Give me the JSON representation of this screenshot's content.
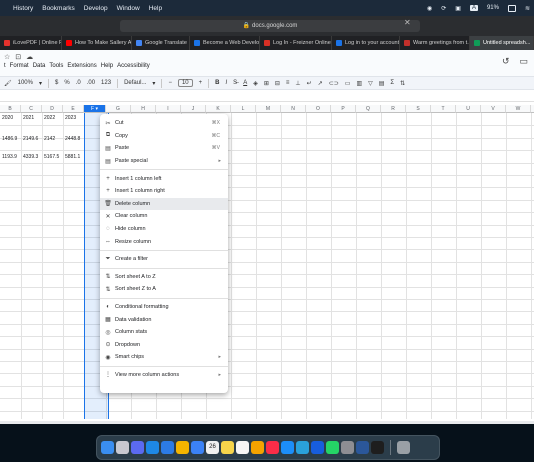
{
  "mac_menubar": {
    "items": [
      "History",
      "Bookmarks",
      "Develop",
      "Window",
      "Help"
    ],
    "battery": "91%"
  },
  "browser": {
    "url": "docs.google.com",
    "tabs": [
      {
        "label": "iLovePDF | Online PDF...",
        "color": "#e5322d"
      },
      {
        "label": "How To Make Sallery A...",
        "color": "#ff0000"
      },
      {
        "label": "Google Translate",
        "color": "#4285f4"
      },
      {
        "label": "Become a Web Develo...",
        "color": "#1a73e8"
      },
      {
        "label": "Log In - Freizner Online",
        "color": "#d93025"
      },
      {
        "label": "Log in to your account...",
        "color": "#1a73e8"
      },
      {
        "label": "Warm greetings from t...",
        "color": "#c4302b"
      },
      {
        "label": "Untitled spreadsh...",
        "color": "#0f9d58"
      }
    ]
  },
  "sheets": {
    "menus": [
      "t",
      "Format",
      "Data",
      "Tools",
      "Extensions",
      "Help",
      "Accessibility"
    ],
    "toolbar": {
      "zoom": "100%",
      "currency": "$",
      "percent": "%",
      "decimals_dec": ".0",
      "decimals_inc": ".00",
      "numfmt": "123",
      "font": "Defaul...",
      "font_size": "10",
      "bold": "B",
      "italic": "I"
    },
    "columns": [
      "B",
      "C",
      "D",
      "E",
      "F",
      "G",
      "H",
      "I",
      "J",
      "K",
      "L",
      "M",
      "N",
      "O",
      "P",
      "Q",
      "R",
      "S",
      "T",
      "U",
      "V",
      "W",
      "X"
    ],
    "selected_column": "F",
    "cells": {
      "row1": [
        "2020",
        "2021",
        "2022",
        "2023"
      ],
      "row2": [
        "1486.9",
        "2149.6",
        "2142",
        "2448.8"
      ],
      "row3": [
        "1193.9",
        "4339.3",
        "5167.5",
        "5881.1"
      ]
    }
  },
  "context_menu": {
    "groups": [
      [
        {
          "icon": "scissors-icon",
          "glyph": "✂",
          "label": "Cut",
          "shortcut": "⌘X"
        },
        {
          "icon": "copy-icon",
          "glyph": "⧉",
          "label": "Copy",
          "shortcut": "⌘C"
        },
        {
          "icon": "paste-icon",
          "glyph": "▤",
          "label": "Paste",
          "shortcut": "⌘V"
        },
        {
          "icon": "paste-special-icon",
          "glyph": "▤",
          "label": "Paste special",
          "arrow": "▸"
        }
      ],
      [
        {
          "icon": "plus-icon",
          "glyph": "+",
          "label": "Insert 1 column left"
        },
        {
          "icon": "plus-icon",
          "glyph": "+",
          "label": "Insert 1 column right"
        },
        {
          "icon": "trash-icon",
          "glyph": "🗑",
          "label": "Delete column",
          "hover": true
        },
        {
          "icon": "close-icon",
          "glyph": "✕",
          "label": "Clear column"
        },
        {
          "icon": "hide-icon",
          "glyph": "◌",
          "label": "Hide column"
        },
        {
          "icon": "resize-icon",
          "glyph": "⇔",
          "label": "Resize column"
        }
      ],
      [
        {
          "icon": "filter-icon",
          "glyph": "⏷",
          "label": "Create a filter"
        }
      ],
      [
        {
          "icon": "sort-icon",
          "glyph": "⇅",
          "label": "Sort sheet A to Z"
        },
        {
          "icon": "sort-icon",
          "glyph": "⇅",
          "label": "Sort sheet Z to A"
        }
      ],
      [
        {
          "icon": "palette-icon",
          "glyph": "◐",
          "label": "Conditional formatting"
        },
        {
          "icon": "validation-icon",
          "glyph": "▦",
          "label": "Data validation"
        },
        {
          "icon": "lightbulb-icon",
          "glyph": "◎",
          "label": "Column stats"
        },
        {
          "icon": "dropdown-icon",
          "glyph": "⊙",
          "label": "Dropdown"
        },
        {
          "icon": "smart-chips-icon",
          "glyph": "◉",
          "label": "Smart chips",
          "arrow": "▸"
        }
      ],
      [
        {
          "icon": "more-vert-icon",
          "glyph": "⋮",
          "label": "View more column actions",
          "arrow": "▸"
        }
      ]
    ]
  },
  "dock": {
    "date_badge": "26",
    "apps": [
      {
        "name": "finder-icon",
        "color": "#3a8ef0"
      },
      {
        "name": "launchpad-icon",
        "color": "#c8c8d0"
      },
      {
        "name": "notes-blue-icon",
        "color": "#5b6af0"
      },
      {
        "name": "vscode-icon",
        "color": "#1e88e5"
      },
      {
        "name": "safari-icon",
        "color": "#2c7be5"
      },
      {
        "name": "chrome-icon",
        "color": "#f4b400"
      },
      {
        "name": "mail-icon",
        "color": "#3b82f6"
      },
      {
        "name": "calendar-icon",
        "color": "#f0f0f0"
      },
      {
        "name": "notes-icon",
        "color": "#f6d44b"
      },
      {
        "name": "reminders-icon",
        "color": "#f5f5f5"
      },
      {
        "name": "photos-icon",
        "color": "#f4a300"
      },
      {
        "name": "music-icon",
        "color": "#fa2d48"
      },
      {
        "name": "appstore-icon",
        "color": "#1c8ef9"
      },
      {
        "name": "telegram-icon",
        "color": "#2aa1da"
      },
      {
        "name": "bitwarden-icon",
        "color": "#175ddc"
      },
      {
        "name": "whatsapp-icon",
        "color": "#25d366"
      },
      {
        "name": "settings-icon",
        "color": "#8e8e93"
      },
      {
        "name": "word-icon",
        "color": "#2b579a"
      },
      {
        "name": "terminal-icon",
        "color": "#1e1e1e"
      },
      {
        "name": "trash-icon",
        "color": "#9aa0a6"
      }
    ]
  }
}
